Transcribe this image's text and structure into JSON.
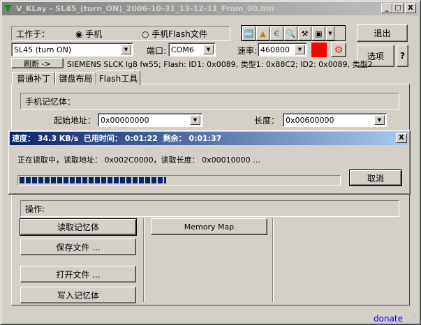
{
  "window": {
    "title": "V_KLay - SL45_(turn_ON)_2006-10-31_13-12-11_From_00.bin",
    "minimize": "_",
    "maximize": "□",
    "close": "X"
  },
  "work": {
    "label": "工作于：",
    "options": [
      {
        "label": "手机",
        "checked": true
      },
      {
        "label": "手机Flash文件",
        "checked": false
      }
    ]
  },
  "toolbar": {
    "icons": [
      "abc-icon",
      "rocket-icon",
      "ce-icon",
      "magnifier-icon",
      "tools-icon",
      "window-icon",
      "dropdown-icon"
    ]
  },
  "buttons": {
    "exit": "退出",
    "options": "选项",
    "help": "?",
    "refresh": "刷新 ->"
  },
  "phone_combo": {
    "value": "SL45 (turn ON)"
  },
  "port": {
    "label": "端口:",
    "value": "COM6"
  },
  "rate": {
    "label": "速率:",
    "value": "460800"
  },
  "colors": {
    "status": "#ff0000",
    "accent": "#0a246a"
  },
  "info": "SIEMENS SLCK lg8 fw55; Flash: ID1: 0x0089, 类型1: 0x88C2; ID2: 0x0089, 类型2",
  "tabs": [
    {
      "label": "普通补丁"
    },
    {
      "label": "键盘布局"
    },
    {
      "label": "Flash工具",
      "active": true
    }
  ],
  "memory": {
    "group_label": "手机记忆体：",
    "start_label": "起始地址：",
    "start_value": "0x00000000",
    "length_label": "长度：",
    "length_value": "0x00600000"
  },
  "progress_dialog": {
    "title": "速度： 34.3 KB/s  已用时间： 0:01:22  剩余： 0:01:37",
    "message": "正在读取中，读取地址： 0x002C0000，读取长度： 0x00010000 ...",
    "progress_percent": 46,
    "cancel": "取消",
    "close": "X"
  },
  "ops": {
    "label": "操作:",
    "read": "读取记忆体",
    "save": "保存文件 ...",
    "open": "打开文件 ...",
    "write": "写入记忆体",
    "memory_map": "Memory Map"
  },
  "status": {
    "donate": "donate"
  }
}
